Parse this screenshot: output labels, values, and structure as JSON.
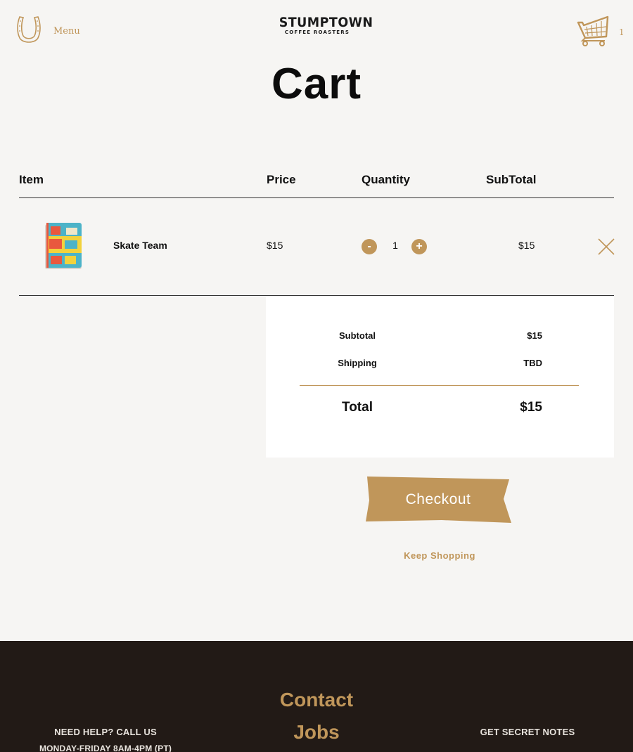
{
  "header": {
    "menu_label": "Menu",
    "menu_icon": "horseshoe-icon",
    "logo_main": "STUMPTOWN",
    "logo_sub": "COFFEE ROASTERS",
    "cart_icon": "shopping-cart-icon",
    "cart_count": "1"
  },
  "page_title": "Cart",
  "table": {
    "headers": [
      "Item",
      "Price",
      "Quantity",
      "SubTotal"
    ],
    "rows": [
      {
        "name": "Skate Team",
        "price": "$15",
        "quantity": "1",
        "subtotal": "$15"
      }
    ],
    "decrement_label": "-",
    "increment_label": "+"
  },
  "summary": {
    "subtotal_label": "Subtotal",
    "subtotal_value": "$15",
    "shipping_label": "Shipping",
    "shipping_value": "TBD",
    "total_label": "Total",
    "total_value": "$15"
  },
  "actions": {
    "checkout_label": "Checkout",
    "keep_shopping_label": "Keep Shopping"
  },
  "footer": {
    "help_heading": "NEED HELP? CALL US",
    "help_hours": "MONDAY-FRIDAY 8AM-4PM (PT)",
    "links": [
      "Contact",
      "Jobs"
    ],
    "newsletter_heading": "GET SECRET NOTES"
  },
  "colors": {
    "accent": "#c0965a",
    "background": "#f6f5f3",
    "footer_bg": "#221a16"
  }
}
